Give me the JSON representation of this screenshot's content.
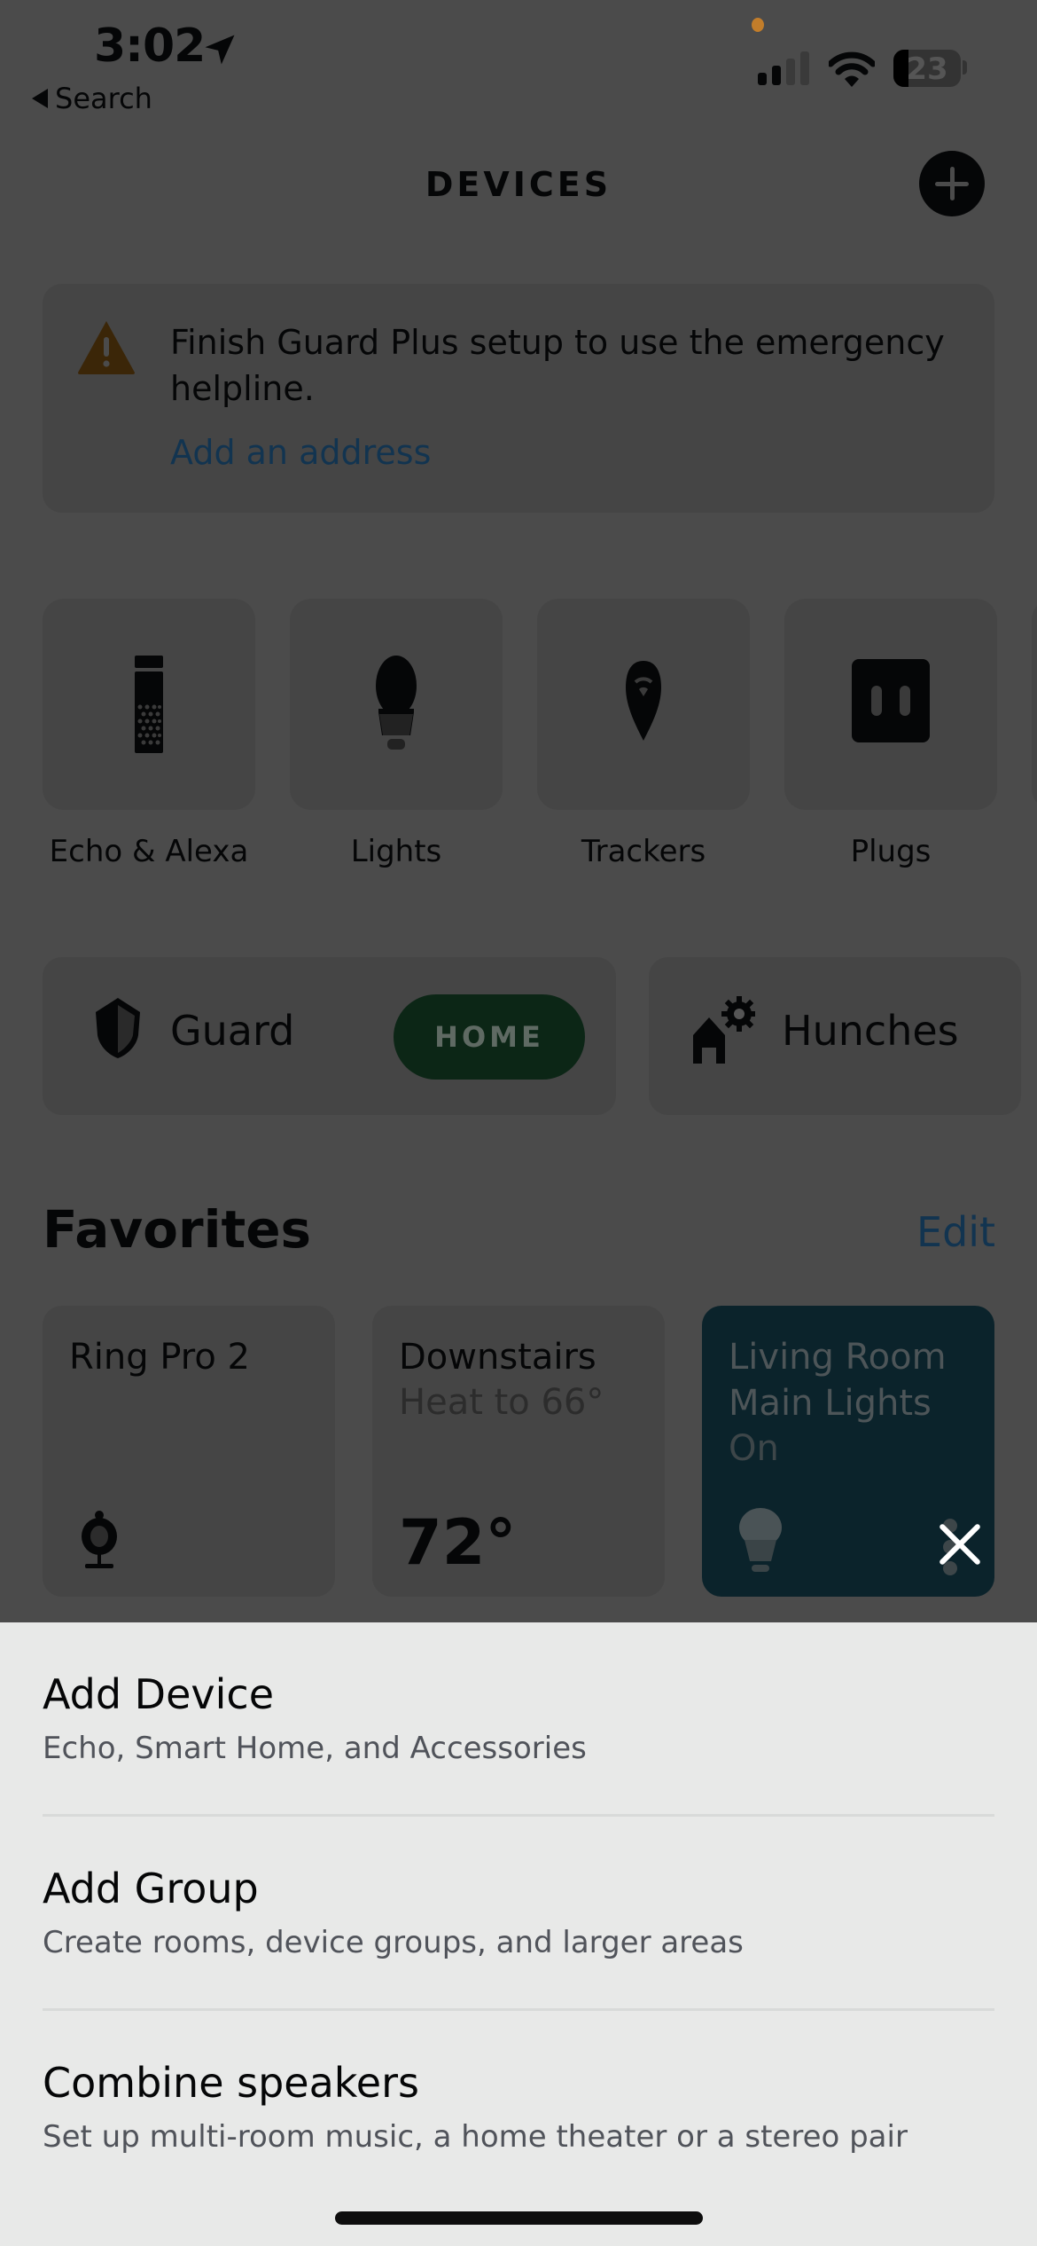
{
  "status_bar": {
    "time": "3:02",
    "back_label": "Search",
    "battery_level": "23",
    "battery_fraction": 0.23,
    "icons": [
      "location-arrow-icon",
      "signal-icon",
      "wifi-icon",
      "battery-icon"
    ]
  },
  "header": {
    "title": "DEVICES",
    "add_button_icon": "plus-icon"
  },
  "alert": {
    "icon": "warning-icon",
    "message": "Finish Guard Plus setup to use the emergency helpline.",
    "link": "Add an address"
  },
  "categories": [
    {
      "label": "Echo & Alexa",
      "icon": "echo-speaker-icon"
    },
    {
      "label": "Lights",
      "icon": "lightbulb-icon"
    },
    {
      "label": "Trackers",
      "icon": "tracker-pin-icon"
    },
    {
      "label": "Plugs",
      "icon": "plug-icon"
    }
  ],
  "guard": {
    "label": "Guard",
    "mode": "HOME",
    "icon": "shield-icon"
  },
  "hunches": {
    "label": "Hunches",
    "icon": "home-gear-icon"
  },
  "favorites": {
    "title": "Favorites",
    "edit_label": "Edit",
    "items": [
      {
        "name": "Ring Pro 2",
        "icon": "camera-icon"
      },
      {
        "name": "Downstairs",
        "subtitle": "Heat to 66°",
        "value": "72°"
      },
      {
        "name": "Living Room Main Lights",
        "status": "On",
        "icon": "lightbulb-icon"
      }
    ]
  },
  "sheet": {
    "close_icon": "close-icon",
    "options": [
      {
        "title": "Add Device",
        "subtitle": "Echo, Smart Home, and Accessories"
      },
      {
        "title": "Add Group",
        "subtitle": "Create rooms, device groups, and larger areas"
      },
      {
        "title": "Combine speakers",
        "subtitle": "Set up multi-room music, a home theater or a stereo pair"
      }
    ]
  },
  "colors": {
    "overlay_bg": "#4b4b4b",
    "card_bg": "#454545",
    "link": "#123450",
    "guard_home_pill": "#0c2616",
    "active_tile": "#0b232b",
    "sheet_bg": "#e8e9e8"
  }
}
